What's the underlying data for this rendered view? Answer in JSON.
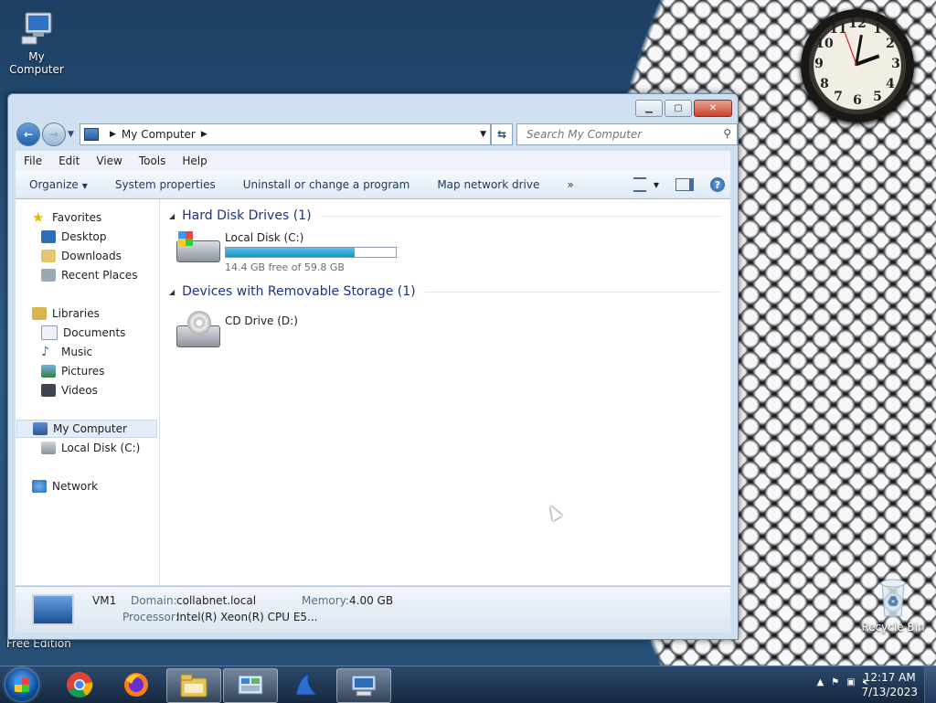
{
  "desktop": {
    "icons": [
      {
        "label": "My Computer"
      },
      {
        "label": "Recycle Bin"
      }
    ],
    "edition_text": "Free Edition"
  },
  "clock_gadget": {
    "numbers": [
      "12",
      "1",
      "2",
      "3",
      "4",
      "5",
      "6",
      "7",
      "8",
      "9",
      "10",
      "11"
    ]
  },
  "window": {
    "nav": {
      "back_icon": "back-arrow-icon",
      "forward_icon": "forward-arrow-icon",
      "address_path": "My Computer",
      "search_placeholder": "Search My Computer"
    },
    "menu": [
      "File",
      "Edit",
      "View",
      "Tools",
      "Help"
    ],
    "commands": {
      "organize": "Organize",
      "system_properties": "System properties",
      "uninstall": "Uninstall or change a program",
      "map_drive": "Map network drive",
      "more": "»"
    },
    "navpane": {
      "favorites": "Favorites",
      "desktop": "Desktop",
      "downloads": "Downloads",
      "recent": "Recent Places",
      "libraries": "Libraries",
      "documents": "Documents",
      "music": "Music",
      "pictures": "Pictures",
      "videos": "Videos",
      "mycomputer": "My Computer",
      "localdisk": "Local Disk (C:)",
      "network": "Network"
    },
    "groups": {
      "hdd": "Hard Disk Drives (1)",
      "removable": "Devices with Removable Storage (1)"
    },
    "drives": {
      "c_label": "Local Disk (C:)",
      "c_free": "14.4 GB free of 59.8 GB",
      "c_used_fraction": 0.759,
      "d_label": "CD Drive (D:)"
    },
    "details": {
      "name": "VM1",
      "domain_key": "Domain:",
      "domain_val": "collabnet.local",
      "memory_key": "Memory:",
      "memory_val": "4.00 GB",
      "processor_key": "Processor:",
      "processor_val": "Intel(R) Xeon(R) CPU E5..."
    }
  },
  "taskbar": {
    "apps": [
      "chrome-icon",
      "firefox-icon",
      "explorer-icon",
      "control-panel-icon",
      "app-icon",
      "remote-desktop-icon"
    ],
    "time": "12:17 AM",
    "date": "7/13/2023"
  }
}
